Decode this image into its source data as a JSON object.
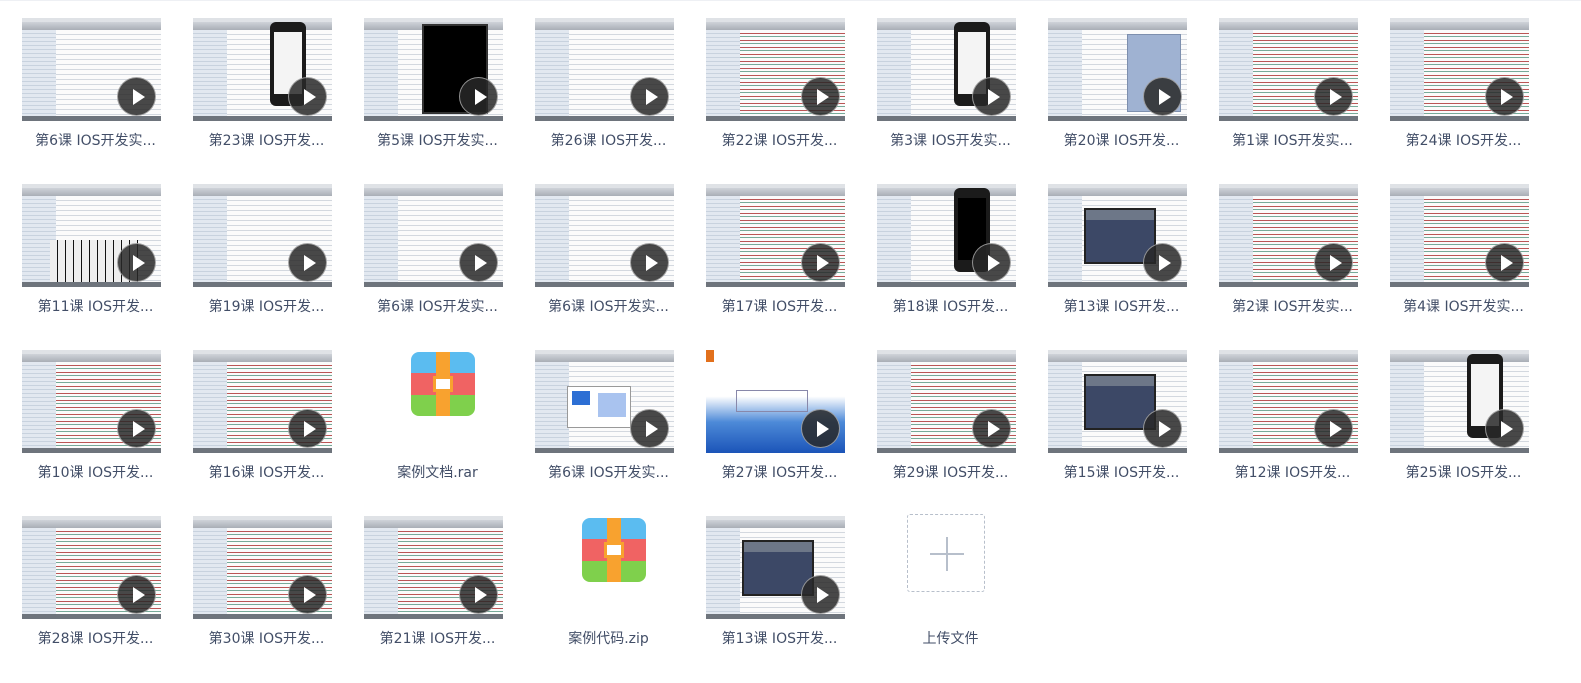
{
  "files": [
    {
      "name": "第6课 IOS开发实...",
      "type": "video",
      "thumb": "form"
    },
    {
      "name": "第23课 IOS开发...",
      "type": "video",
      "thumb": "phone"
    },
    {
      "name": "第5课 IOS开发实...",
      "type": "video",
      "thumb": "black"
    },
    {
      "name": "第26课 IOS开发...",
      "type": "video",
      "thumb": "table"
    },
    {
      "name": "第22课 IOS开发...",
      "type": "video",
      "thumb": "code"
    },
    {
      "name": "第3课 IOS开发实...",
      "type": "video",
      "thumb": "phone"
    },
    {
      "name": "第20课 IOS开发...",
      "type": "video",
      "thumb": "bluepanel"
    },
    {
      "name": "第1课 IOS开发实...",
      "type": "video",
      "thumb": "code"
    },
    {
      "name": "第24课 IOS开发...",
      "type": "video",
      "thumb": "code"
    },
    {
      "name": "第11课 IOS开发...",
      "type": "video",
      "thumb": "keys"
    },
    {
      "name": "第19课 IOS开发...",
      "type": "video",
      "thumb": "form"
    },
    {
      "name": "第6课 IOS开发实...",
      "type": "video",
      "thumb": "form"
    },
    {
      "name": "第6课 IOS开发实...",
      "type": "video",
      "thumb": "form"
    },
    {
      "name": "第17课 IOS开发...",
      "type": "video",
      "thumb": "code"
    },
    {
      "name": "第18课 IOS开发...",
      "type": "video",
      "thumb": "phoneblk"
    },
    {
      "name": "第13课 IOS开发...",
      "type": "video",
      "thumb": "panel"
    },
    {
      "name": "第2课 IOS开发实...",
      "type": "video",
      "thumb": "code"
    },
    {
      "name": "第4课 IOS开发实...",
      "type": "video",
      "thumb": "code"
    },
    {
      "name": "第10课 IOS开发...",
      "type": "video",
      "thumb": "codered"
    },
    {
      "name": "第16课 IOS开发...",
      "type": "video",
      "thumb": "codered"
    },
    {
      "name": "案例文档.rar",
      "type": "archive"
    },
    {
      "name": "第6课 IOS开发实...",
      "type": "video",
      "thumb": "popup"
    },
    {
      "name": "第27课 IOS开发...",
      "type": "video",
      "thumb": "slide"
    },
    {
      "name": "第29课 IOS开发...",
      "type": "video",
      "thumb": "code"
    },
    {
      "name": "第15课 IOS开发...",
      "type": "video",
      "thumb": "panel"
    },
    {
      "name": "第12课 IOS开发...",
      "type": "video",
      "thumb": "code"
    },
    {
      "name": "第25课 IOS开发...",
      "type": "video",
      "thumb": "phone"
    },
    {
      "name": "第28课 IOS开发...",
      "type": "video",
      "thumb": "codered"
    },
    {
      "name": "第30课 IOS开发...",
      "type": "video",
      "thumb": "codered"
    },
    {
      "name": "第21课 IOS开发...",
      "type": "video",
      "thumb": "codered"
    },
    {
      "name": "案例代码.zip",
      "type": "archive"
    },
    {
      "name": "第13课 IOS开发...",
      "type": "video",
      "thumb": "panel"
    }
  ],
  "upload": {
    "label": "上传文件",
    "icon": "plus-icon"
  },
  "colors": {
    "caption": "#424e67",
    "play": "#2a2a2a",
    "upload_border": "#b7bfcb"
  }
}
